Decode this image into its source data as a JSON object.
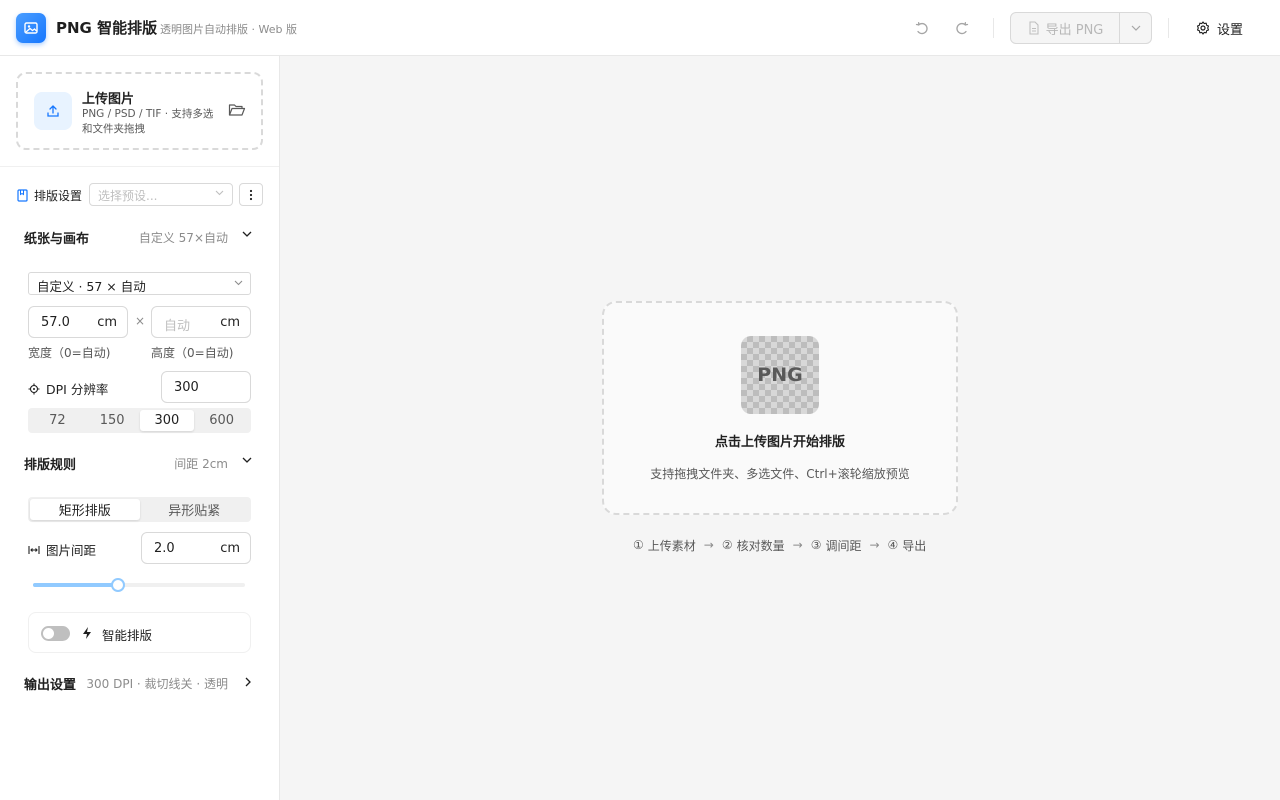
{
  "header": {
    "title": "PNG 智能排版",
    "subtitle": "透明图片自动排版 · Web 版",
    "export_label": "导出 PNG",
    "settings_label": "设置"
  },
  "upload": {
    "title": "上传图片",
    "description": "PNG / PSD / TIF · 支持多选和文件夹拖拽"
  },
  "preset": {
    "label": "排版设置",
    "placeholder": "选择预设..."
  },
  "paper": {
    "title": "纸张与画布",
    "summary": "自定义 57×自动",
    "size_select": "自定义 · 57 × 自动",
    "width_value": "57.0",
    "width_unit": "cm",
    "height_placeholder": "自动",
    "height_unit": "cm",
    "times": "×",
    "width_caption": "宽度（0=自动)",
    "height_caption": "高度（0=自动)",
    "dpi_label": "DPI 分辨率",
    "dpi_value": "300",
    "dpi_options": [
      "72",
      "150",
      "300",
      "600"
    ],
    "dpi_selected": "300"
  },
  "layout": {
    "title": "排版规则",
    "summary": "间距 2cm",
    "modes": [
      "矩形排版",
      "异形贴紧"
    ],
    "mode_selected": "矩形排版",
    "spacing_label": "图片间距",
    "spacing_value": "2.0",
    "spacing_unit": "cm",
    "spacing_slider_fraction": 0.4,
    "smart_label": "智能排版",
    "smart_enabled": false
  },
  "output": {
    "title": "输出设置",
    "summary": "300 DPI · 裁切线关 · 透明"
  },
  "canvas": {
    "tile_label": "PNG",
    "title": "点击上传图片开始排版",
    "description": "支持拖拽文件夹、多选文件、Ctrl+滚轮缩放预览",
    "steps": [
      {
        "num": "①",
        "label": "上传素材"
      },
      {
        "num": "②",
        "label": "核对数量"
      },
      {
        "num": "③",
        "label": "调间距"
      },
      {
        "num": "④",
        "label": "导出"
      }
    ],
    "arrow": "→"
  },
  "colors": {
    "accent": "#1677ff",
    "accent_light": "#91caff",
    "toggle_off": "#bfbfbf"
  },
  "icons": {
    "logo": "image-icon",
    "undo": "undo-icon",
    "redo": "redo-icon",
    "export": "file-icon",
    "dropdown": "chevron-down-icon",
    "settings": "gear-icon",
    "upload": "upload-icon",
    "folder": "folder-open-icon",
    "preset": "bookmark-icon",
    "more": "more-vertical-icon",
    "dpi": "crosshair-icon",
    "spacing": "spacing-icon",
    "smart": "bolt-icon",
    "expand": "chevron-right-icon"
  }
}
